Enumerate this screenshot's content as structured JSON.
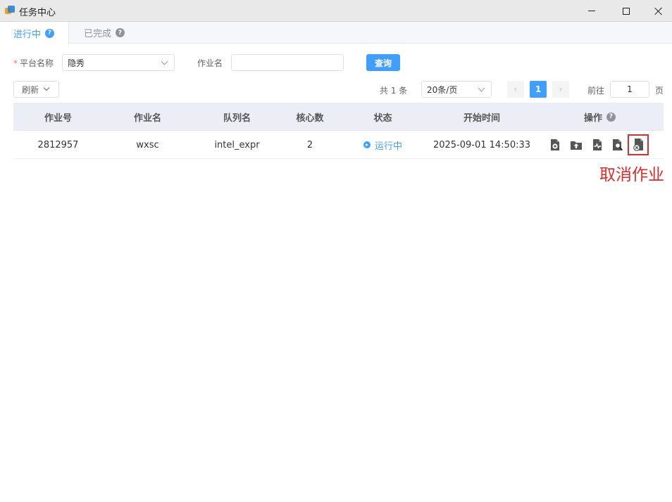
{
  "window": {
    "title": "任务中心",
    "app_icon": "app-logo-icon",
    "controls": [
      "minimize-icon",
      "maximize-icon",
      "close-icon"
    ]
  },
  "tabs": [
    {
      "label": "进行中",
      "active": true,
      "icon": "help-icon"
    },
    {
      "label": "已完成",
      "active": false,
      "icon": "help-icon"
    }
  ],
  "filters": {
    "platform": {
      "label": "平台名称",
      "required_mark": "*",
      "value": "隐秀"
    },
    "job_name": {
      "label": "作业名",
      "value": "",
      "placeholder": ""
    },
    "search_label": "查询"
  },
  "toolbar": {
    "refresh_label": "刷新",
    "total_label": "共 1 条",
    "page_size": "20条/页",
    "current_page": "1",
    "goto_prefix": "前往",
    "goto_value": "1",
    "goto_suffix": "页"
  },
  "table": {
    "columns": [
      "作业号",
      "作业名",
      "队列名",
      "核心数",
      "状态",
      "开始时间",
      "操作"
    ],
    "rows": [
      {
        "job_id": "2812957",
        "job_name": "wxsc",
        "queue": "intel_expr",
        "cores": "2",
        "status": "运行中",
        "start_time": "2025-09-01 14:50:33"
      }
    ],
    "actions": [
      "settings-file-icon",
      "upload-folder-icon",
      "monitor-file-icon",
      "search-file-icon",
      "cancel-job-icon"
    ]
  },
  "annotation": "取消作业",
  "colors": {
    "accent": "#409eff",
    "highlight": "#e02b2b"
  }
}
